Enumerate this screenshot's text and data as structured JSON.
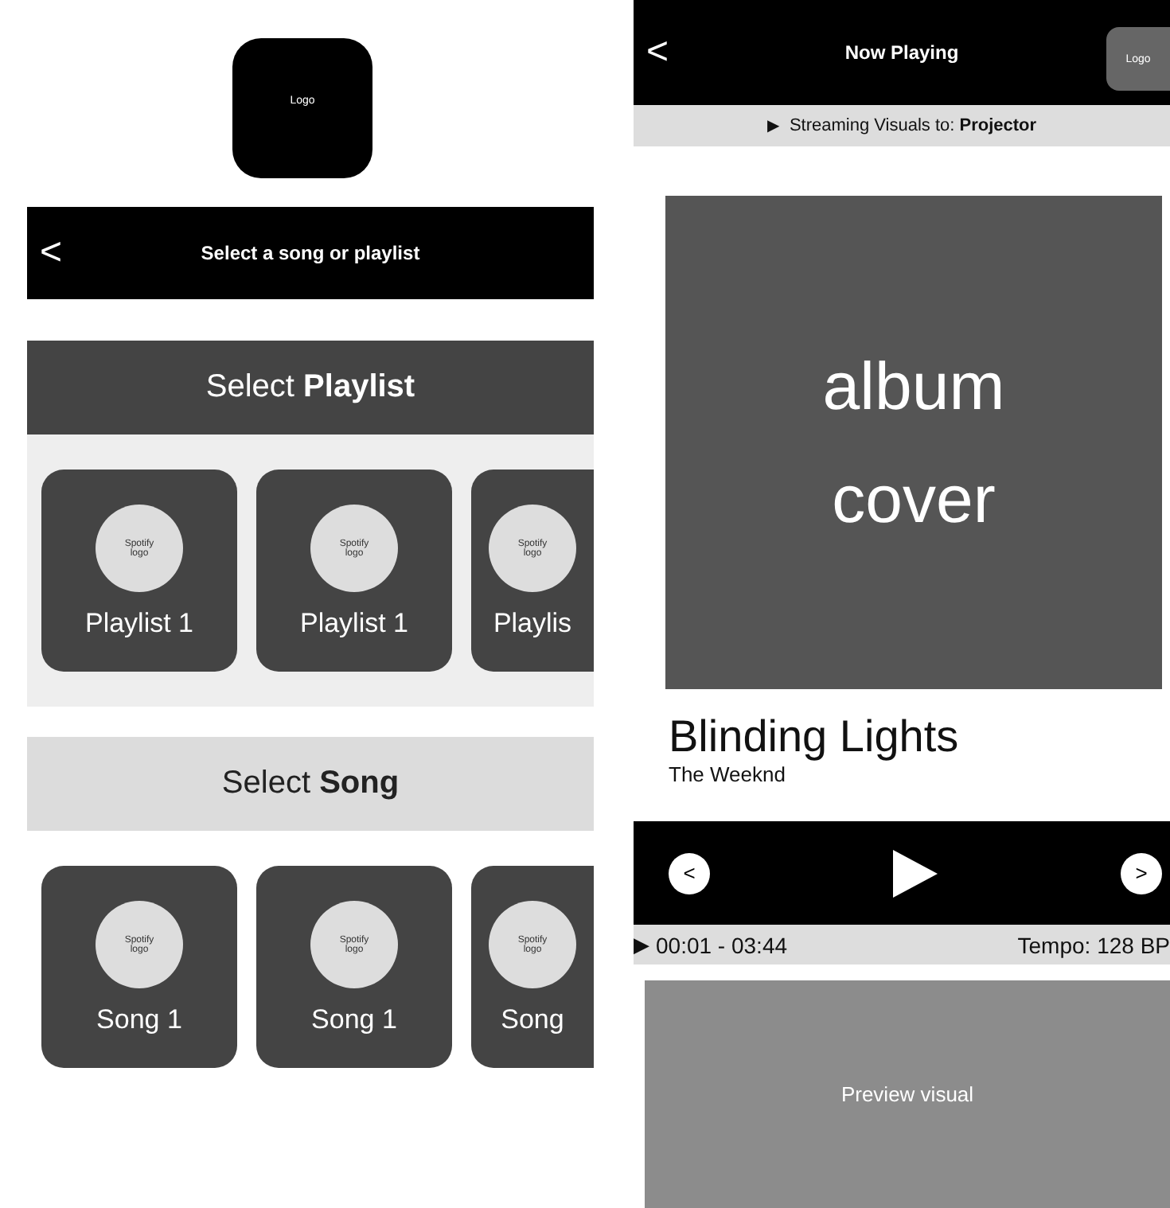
{
  "selector": {
    "logo": "Logo",
    "header": {
      "back": "<",
      "title": "Select a song or playlist"
    },
    "sections": [
      {
        "heading": "Select **Playlist**",
        "selected": true,
        "items": [
          {
            "logo": "Spotify logo",
            "label": "Playlist 1"
          },
          {
            "logo": "Spotify logo",
            "label": "Playlist 1"
          },
          {
            "logo": "Spotify logo",
            "label": "Playlis"
          }
        ]
      },
      {
        "heading": "Select **Song**",
        "selected": false,
        "items": [
          {
            "logo": "Spotify logo",
            "label": "Song 1"
          },
          {
            "logo": "Spotify logo",
            "label": "Song 1"
          },
          {
            "logo": "Spotify logo",
            "label": "Song"
          }
        ]
      }
    ]
  },
  "player": {
    "header": {
      "back": "<",
      "title": "Now Playing",
      "logo": "Logo"
    },
    "streaming": {
      "icon": "▶",
      "text": "Streaming Visuals to: **Projector**"
    },
    "cover": "album cover",
    "title": "Blinding Lights",
    "artist": "The Weeknd",
    "controls": {
      "previous": "<",
      "next": ">"
    },
    "status": {
      "icon": "▶",
      "time": "00:01 - 03:44",
      "tempo": "Tempo: 128 BP"
    },
    "preview": "Preview visual"
  }
}
